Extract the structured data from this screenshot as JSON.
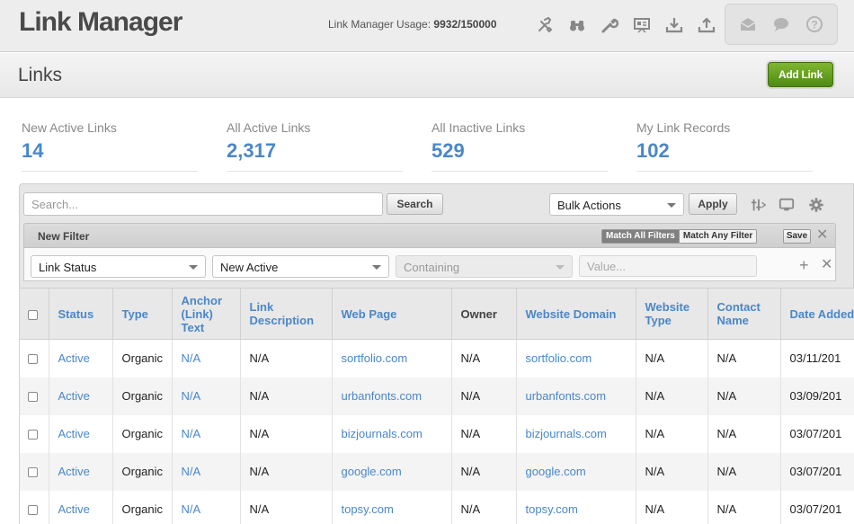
{
  "header": {
    "app_title": "Link Manager",
    "usage_label": "Link Manager Usage:",
    "usage_value": "9932/150000",
    "tool_icons": [
      "tools-icon",
      "binoculars-icon",
      "wrench-icon",
      "presentation-icon",
      "download-icon",
      "upload-icon"
    ],
    "msg_icons": [
      "envelope-icon",
      "chat-icon",
      "help-icon"
    ]
  },
  "subheader": {
    "page_title": "Links",
    "add_link_label": "Add Link"
  },
  "stats": [
    {
      "label": "New Active Links",
      "value": "14"
    },
    {
      "label": "All Active Links",
      "value": "2,317"
    },
    {
      "label": "All Inactive Links",
      "value": "529"
    },
    {
      "label": "My Link Records",
      "value": "102"
    }
  ],
  "toolbar": {
    "search_placeholder": "Search...",
    "search_button": "Search",
    "bulk_actions": "Bulk Actions",
    "apply_button": "Apply"
  },
  "filter": {
    "title": "New Filter",
    "match_all": "Match All Filters",
    "match_any": "Match Any Filter",
    "save": "Save",
    "field": "Link Status",
    "field_value": "New Active",
    "operator": "Containing",
    "value_placeholder": "Value..."
  },
  "table": {
    "columns": [
      "Status",
      "Type",
      "Anchor (Link) Text",
      "Link Description",
      "Web Page",
      "Owner",
      "Website Domain",
      "Website Type",
      "Contact Name",
      "Date Added"
    ],
    "rows": [
      {
        "status": "Active",
        "type": "Organic",
        "anchor": "N/A",
        "desc": "N/A",
        "page": "sortfolio.com",
        "owner": "N/A",
        "domain": "sortfolio.com",
        "wtype": "N/A",
        "contact": "N/A",
        "date": "03/11/201"
      },
      {
        "status": "Active",
        "type": "Organic",
        "anchor": "N/A",
        "desc": "N/A",
        "page": "urbanfonts.com",
        "owner": "N/A",
        "domain": "urbanfonts.com",
        "wtype": "N/A",
        "contact": "N/A",
        "date": "03/09/201"
      },
      {
        "status": "Active",
        "type": "Organic",
        "anchor": "N/A",
        "desc": "N/A",
        "page": "bizjournals.com",
        "owner": "N/A",
        "domain": "bizjournals.com",
        "wtype": "N/A",
        "contact": "N/A",
        "date": "03/07/201"
      },
      {
        "status": "Active",
        "type": "Organic",
        "anchor": "N/A",
        "desc": "N/A",
        "page": "google.com",
        "owner": "N/A",
        "domain": "google.com",
        "wtype": "N/A",
        "contact": "N/A",
        "date": "03/07/201"
      },
      {
        "status": "Active",
        "type": "Organic",
        "anchor": "N/A",
        "desc": "N/A",
        "page": "topsy.com",
        "owner": "N/A",
        "domain": "topsy.com",
        "wtype": "N/A",
        "contact": "N/A",
        "date": "03/07/201"
      }
    ]
  },
  "colors": {
    "accent_blue": "#4a87c8",
    "add_button_green": "#5e9a1e"
  }
}
